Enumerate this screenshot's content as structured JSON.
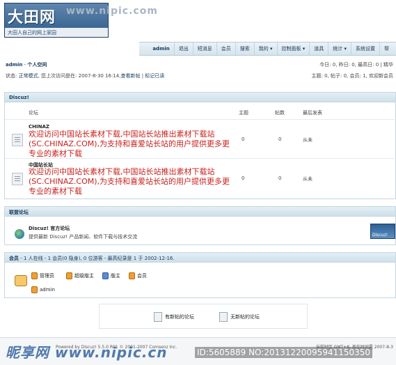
{
  "header": {
    "logo_main": "大田网",
    "logo_sub": "大田人自己的网上家园",
    "watermark": "www.nipic.com"
  },
  "nav": {
    "items": [
      "admin",
      "退出",
      "短消息",
      "会员",
      "搜索",
      "我的 ▾",
      "控制面板 ▾",
      "道具",
      "统计 ▾",
      "系统设置",
      "帮"
    ]
  },
  "status": {
    "breadcrumb_user": "admin",
    "breadcrumb_sep": " - ",
    "breadcrumb_space": "个人空间",
    "line_prefix": "状态: ",
    "mode": "正常模式",
    "line_mid": ", 您上次访问是在: 2007-8-30 16:14,",
    "new_posts_link": "查看新帖",
    "sep": " | ",
    "mark_read_link": "标记已读",
    "right_line1": "今日: 0, 昨日: 0, 最高日: 0 | 精华",
    "right_line2": "主题: 0, 帖子: 0, 会员: 1, 欢迎新会员"
  },
  "forum_section": {
    "title": "Discuz!",
    "col_forum": "论坛",
    "col_topics": "主题",
    "col_posts": "帖数",
    "col_last": "最后发表",
    "forums": [
      {
        "name": "CHINAZ",
        "desc": "欢迎访问中国站长素材下载,中国站长站推出素材下载站(SC.CHINAZ.COM),为支持和喜爱站长站的用户提供更多更专业的素材下载",
        "topics": "0",
        "posts": "0",
        "last": "从未"
      },
      {
        "name": "中国站长站",
        "desc": "欢迎访问中国站长素材下载,中国站长站推出素材下载站(SC.CHINAZ.COM),为支持和喜爱站长站的用户提供更多更专业的素材下载",
        "topics": "0",
        "posts": "0",
        "last": "从未"
      }
    ]
  },
  "links_section": {
    "title": "联盟论坛",
    "name": "Discuz! 官方论坛",
    "desc": "提供最新 Discuz! 产品新闻、软件下载与技术交流",
    "badge": "Discuz!"
  },
  "online_section": {
    "title": "会员",
    "summary": " - 1 人在线 - 1 会员(0 隐身), 0 位游客 - 最高纪录是 1 于 2002-12-16.",
    "legend": [
      "管理员",
      "超级版主",
      "版主",
      "会员"
    ],
    "user": "admin"
  },
  "bottom_legend": {
    "new": "有新帖的论坛",
    "nonew": "无新帖的论坛"
  },
  "footer": {
    "copy": "Powered by Discuz! 5.5.0 RC1 © 2001-2007 Comsenz Inc.",
    "right": "当前时区 GMT+8, 现在时间是 2007-8-3",
    "watermark": "昵享网 www.nipic.cn",
    "watermark_id": "ID:5605889 NO:20131220095941150350"
  },
  "colors": {
    "accent": "#15385a",
    "desc_red": "#c8201c",
    "head_bg": "#d5e4ec"
  }
}
